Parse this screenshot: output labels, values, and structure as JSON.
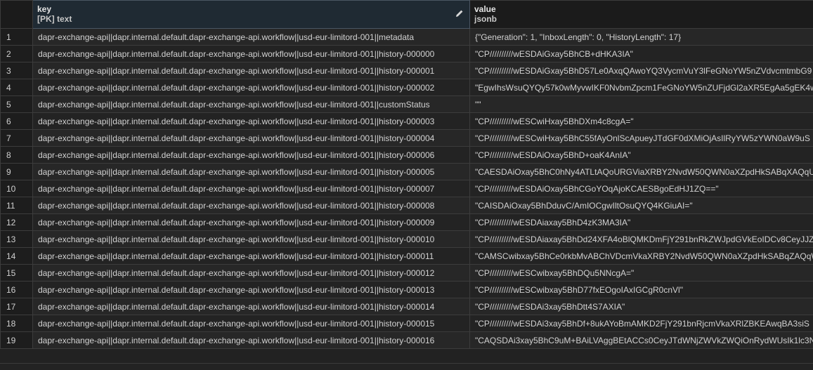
{
  "columns": {
    "key": {
      "name": "key",
      "type": "[PK] text"
    },
    "value": {
      "name": "value",
      "type": "jsonb"
    }
  },
  "rows": [
    {
      "n": "1",
      "key": "dapr-exchange-api||dapr.internal.default.dapr-exchange-api.workflow||usd-eur-limitord-001||metadata",
      "value": "{\"Generation\": 1, \"InboxLength\": 0, \"HistoryLength\": 17}"
    },
    {
      "n": "2",
      "key": "dapr-exchange-api||dapr.internal.default.dapr-exchange-api.workflow||usd-eur-limitord-001||history-000000",
      "value": "\"CP//////////wESDAiGxay5BhCB+dHKA3IA\""
    },
    {
      "n": "3",
      "key": "dapr-exchange-api||dapr.internal.default.dapr-exchange-api.workflow||usd-eur-limitord-001||history-000001",
      "value": "\"CP//////////wESDAiGxay5BhD57Le0AxqQAwoYQ3VycmVuY3lFeGNoYW5nZVdvcmtmbG9"
    },
    {
      "n": "4",
      "key": "dapr-exchange-api||dapr.internal.default.dapr-exchange-api.workflow||usd-eur-limitord-001||history-000002",
      "value": "\"EgwIhsWsuQYQy57k0wMyvwIKF0NvbmZpcm1FeGNoYW5nZUFjdGl2aXR5EgAa5gEK4w"
    },
    {
      "n": "5",
      "key": "dapr-exchange-api||dapr.internal.default.dapr-exchange-api.workflow||usd-eur-limitord-001||customStatus",
      "value": "\"\""
    },
    {
      "n": "6",
      "key": "dapr-exchange-api||dapr.internal.default.dapr-exchange-api.workflow||usd-eur-limitord-001||history-000003",
      "value": "\"CP//////////wESCwiHxay5BhDXm4c8cgA=\""
    },
    {
      "n": "7",
      "key": "dapr-exchange-api||dapr.internal.default.dapr-exchange-api.workflow||usd-eur-limitord-001||history-000004",
      "value": "\"CP//////////wESCwiHxay5BhC55fAyOnlScApueyJTdGF0dXMiOjAsIlRyYW5zYWN0aW9uS"
    },
    {
      "n": "8",
      "key": "dapr-exchange-api||dapr.internal.default.dapr-exchange-api.workflow||usd-eur-limitord-001||history-000006",
      "value": "\"CP//////////wESDAiOxay5BhD+oaK4AnIA\""
    },
    {
      "n": "9",
      "key": "dapr-exchange-api||dapr.internal.default.dapr-exchange-api.workflow||usd-eur-limitord-001||history-000005",
      "value": "\"CAESDAiOxay5BhC0hNy4ATLtAQoURGViaXRBY2NvdW50QWN0aXZpdHkSABqXAQqUAQ"
    },
    {
      "n": "10",
      "key": "dapr-exchange-api||dapr.internal.default.dapr-exchange-api.workflow||usd-eur-limitord-001||history-000007",
      "value": "\"CP//////////wESDAiOxay5BhCGoYOqAjoKCAESBgoEdHJ1ZQ==\""
    },
    {
      "n": "11",
      "key": "dapr-exchange-api||dapr.internal.default.dapr-exchange-api.workflow||usd-eur-limitord-001||history-000008",
      "value": "\"CAISDAiOxay5BhDduvC/AmIOCgwIltOsuQYQ4KGiuAI=\""
    },
    {
      "n": "12",
      "key": "dapr-exchange-api||dapr.internal.default.dapr-exchange-api.workflow||usd-eur-limitord-001||history-000009",
      "value": "\"CP//////////wESDAiaxay5BhD4zK3MA3IA\""
    },
    {
      "n": "13",
      "key": "dapr-exchange-api||dapr.internal.default.dapr-exchange-api.workflow||usd-eur-limitord-001||history-000010",
      "value": "\"CP//////////wESDAiaxay5BhDd24XFA4oBlQMKDmFjY291bnRkZWJpdGVkEoIDCv8CeyJJZ"
    },
    {
      "n": "14",
      "key": "dapr-exchange-api||dapr.internal.default.dapr-exchange-api.workflow||usd-eur-limitord-001||history-000011",
      "value": "\"CAMSCwibxay5BhCe0rkbMvABChVDcmVkaXRBY2NvdW50QWN0aXZpdHkSABqZAQqWAQ"
    },
    {
      "n": "15",
      "key": "dapr-exchange-api||dapr.internal.default.dapr-exchange-api.workflow||usd-eur-limitord-001||history-000012",
      "value": "\"CP//////////wESCwibxay5BhDQu5NNcgA=\""
    },
    {
      "n": "16",
      "key": "dapr-exchange-api||dapr.internal.default.dapr-exchange-api.workflow||usd-eur-limitord-001||history-000013",
      "value": "\"CP//////////wESCwibxay5BhD77fxEOgoIAxIGCgR0cnVl\""
    },
    {
      "n": "17",
      "key": "dapr-exchange-api||dapr.internal.default.dapr-exchange-api.workflow||usd-eur-limitord-001||history-000014",
      "value": "\"CP//////////wESDAi3xay5BhDtt4S7AXIA\""
    },
    {
      "n": "18",
      "key": "dapr-exchange-api||dapr.internal.default.dapr-exchange-api.workflow||usd-eur-limitord-001||history-000015",
      "value": "\"CP//////////wESDAi3xay5BhDf+8ukAYoBmAMKD2FjY291bnRjcmVkaXRlZBKEAwqBA3siS"
    },
    {
      "n": "19",
      "key": "dapr-exchange-api||dapr.internal.default.dapr-exchange-api.workflow||usd-eur-limitord-001||history-000016",
      "value": "\"CAQSDAi3xay5BhC9uM+BAiLVAggBEtACCs0CeyJTdWNjZWVkZWQiOnRydWUsIk1lc3Nh"
    }
  ]
}
